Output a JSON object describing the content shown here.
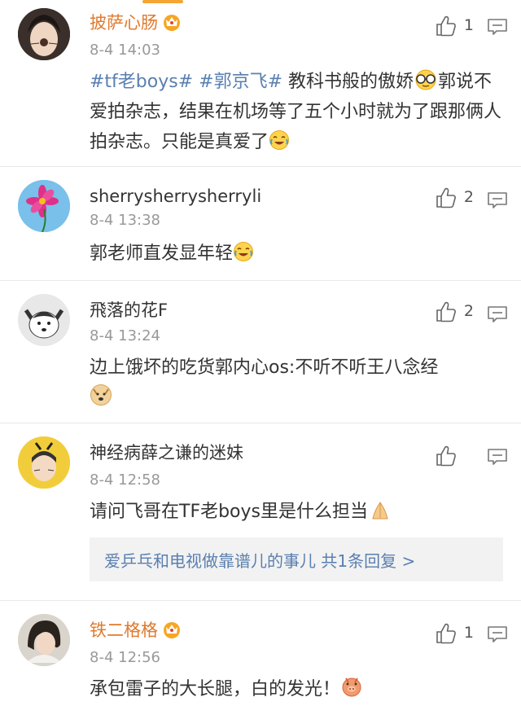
{
  "comments": [
    {
      "username": "披萨心肠",
      "time": "8-4 14:03",
      "likes": "1",
      "text_parts": [
        "#tf老boys#",
        " ",
        "#郭京飞#",
        " 教科书般的傲娇",
        "郭说不爱拍杂志，结果在机场等了五个小时就为了跟那俩人拍杂志。只能是真爱了"
      ],
      "has_vip": true
    },
    {
      "username": "sherrysherrysherryli",
      "time": "8-4 13:38",
      "likes": "2",
      "text": "郭老师直发显年轻"
    },
    {
      "username": "飛落的花F",
      "time": "8-4 13:24",
      "likes": "2",
      "text": "边上饿坏的吃货郭内心os:不听不听王八念经"
    },
    {
      "username": "神经病薛之谦的迷妹",
      "time": "8-4 12:58",
      "likes": "",
      "text": "请问飞哥在TF老boys里是什么担当",
      "reply": "爱乒乓和电视做靠谱儿的事儿 共1条回复 >"
    },
    {
      "username": "铁二格格",
      "time": "8-4 12:56",
      "likes": "1",
      "text": "承包雷子的大长腿，白的发光！",
      "has_vip": true
    }
  ],
  "icons": {
    "like": "thumbs-up-icon",
    "reply": "comment-icon",
    "vip": "crown-vip-icon"
  },
  "colors": {
    "username_vip": "#e07a2e",
    "topic_link": "#5a7fb0",
    "timestamp": "#999999",
    "reply_bg": "#f2f2f2",
    "top_indicator": "#f4a533"
  }
}
